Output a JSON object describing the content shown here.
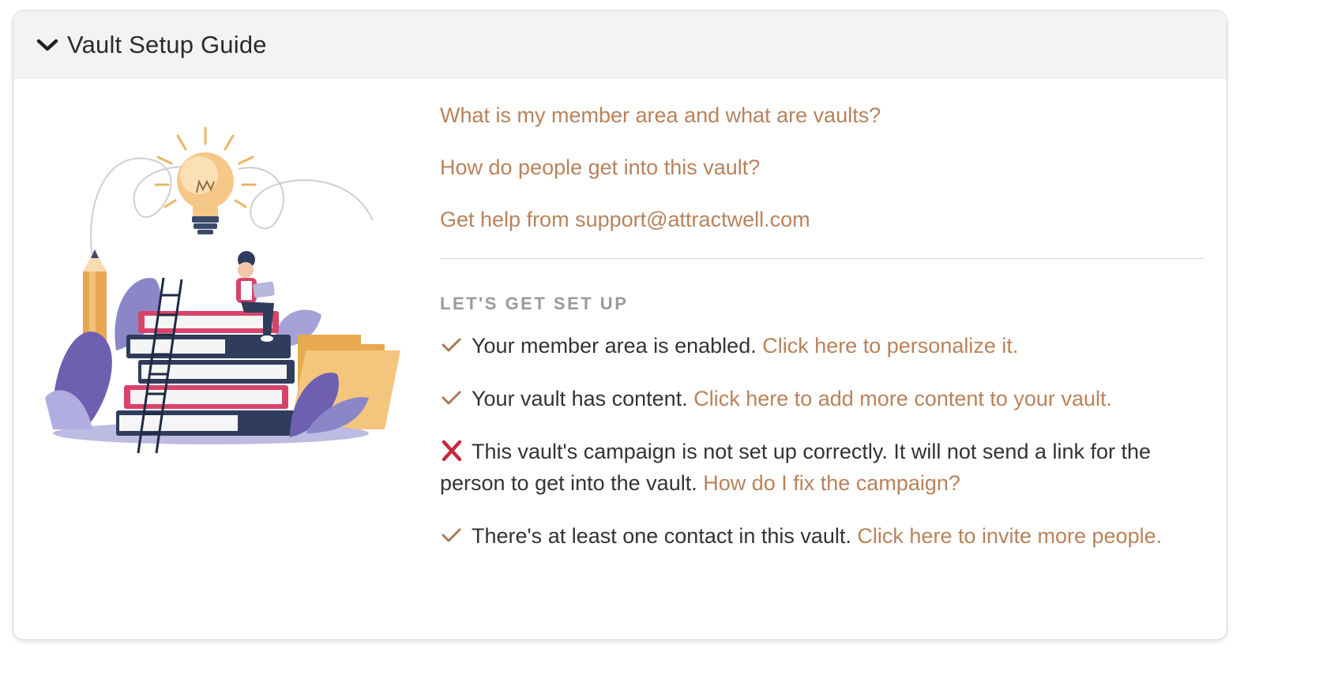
{
  "header": {
    "title": "Vault Setup Guide",
    "icon": "chevron-down-icon"
  },
  "faq": {
    "links": [
      "What is my member area and what are vaults?",
      "How do people get into this vault?",
      "Get help from support@attractwell.com"
    ]
  },
  "setup": {
    "heading": "LET'S GET SET UP",
    "steps": [
      {
        "status": "complete",
        "icon": "checkmark-icon",
        "text": "Your member area is enabled. ",
        "link": "Click here to personalize it."
      },
      {
        "status": "complete",
        "icon": "checkmark-icon",
        "text": "Your vault has content. ",
        "link": "Click here to add more content to your vault."
      },
      {
        "status": "error",
        "icon": "x-mark-icon",
        "text": "This vault's campaign is not set up correctly. It will not send a link for the person to get into the vault. ",
        "link": "How do I fix the campaign?"
      },
      {
        "status": "complete",
        "icon": "checkmark-icon",
        "text": "There's at least one contact in this vault. ",
        "link": "Click here to invite more people."
      }
    ]
  },
  "colors": {
    "link": "#b9825a",
    "check": "#a87a56",
    "error": "#c8283c",
    "text": "#333333",
    "heading": "#9a9a9a",
    "header_bg": "#f3f3f3"
  }
}
